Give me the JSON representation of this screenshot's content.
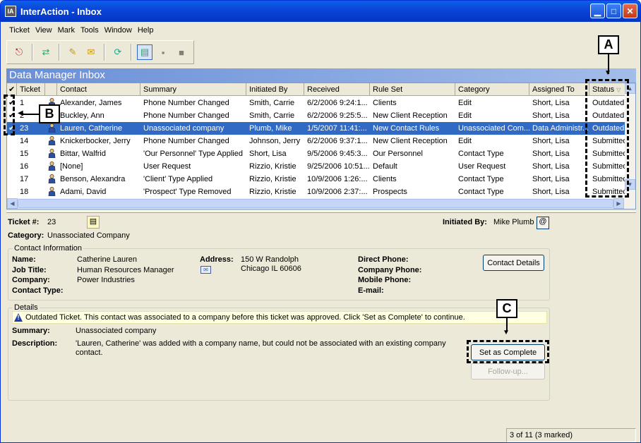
{
  "window": {
    "title": "InterAction - Inbox",
    "app_icon": "IA"
  },
  "menu": [
    "Ticket",
    "View",
    "Mark",
    "Tools",
    "Window",
    "Help"
  ],
  "inbox_title": "Data Manager Inbox",
  "columns": [
    "Ticket",
    "Contact",
    "Summary",
    "Initiated By",
    "Received",
    "Rule Set",
    "Category",
    "Assigned To",
    "Status"
  ],
  "rows": [
    {
      "check": "✔",
      "ticket": "1",
      "contact": "Alexander, James",
      "summary": "Phone Number Changed",
      "initiated_by": "Smith, Carrie",
      "received": "6/2/2006 9:24:1...",
      "rule_set": "Clients",
      "category": "Edit",
      "assigned_to": "Short, Lisa",
      "status": "Outdated"
    },
    {
      "check": "✔",
      "ticket": "2",
      "contact": "Buckley, Ann",
      "summary": "Phone Number Changed",
      "initiated_by": "Smith, Carrie",
      "received": "6/2/2006 9:25:5...",
      "rule_set": "New Client Reception",
      "category": "Edit",
      "assigned_to": "Short, Lisa",
      "status": "Outdated"
    },
    {
      "check": "✔",
      "ticket": "23",
      "contact": "Lauren, Catherine",
      "summary": "Unassociated company",
      "initiated_by": "Plumb, Mike",
      "received": "1/5/2007 11:41:...",
      "rule_set": "New Contact Rules",
      "category": "Unassociated Com...",
      "assigned_to": "Data Administr...",
      "status": "Outdated",
      "selected": true
    },
    {
      "check": "",
      "ticket": "14",
      "contact": "Knickerbocker, Jerry",
      "summary": "Phone Number Changed",
      "initiated_by": "Johnson, Jerry",
      "received": "6/2/2006 9:37:1...",
      "rule_set": "New Client Reception",
      "category": "Edit",
      "assigned_to": "Short, Lisa",
      "status": "Submitted"
    },
    {
      "check": "",
      "ticket": "15",
      "contact": "Bittar, Walfrid",
      "summary": "'Our Personnel' Type Applied",
      "initiated_by": "Short, Lisa",
      "received": "9/5/2006 9:45:3...",
      "rule_set": "Our Personnel",
      "category": "Contact Type",
      "assigned_to": "Short, Lisa",
      "status": "Submitted"
    },
    {
      "check": "",
      "ticket": "16",
      "contact": "[None]",
      "summary": "User Request",
      "initiated_by": "Rizzio, Kristie",
      "received": "9/25/2006 10:51...",
      "rule_set": "Default",
      "category": "User Request",
      "assigned_to": "Short, Lisa",
      "status": "Submitted"
    },
    {
      "check": "",
      "ticket": "17",
      "contact": "Benson, Alexandra",
      "summary": "'Client' Type Applied",
      "initiated_by": "Rizzio, Kristie",
      "received": "10/9/2006 1:26:...",
      "rule_set": "Clients",
      "category": "Contact Type",
      "assigned_to": "Short, Lisa",
      "status": "Submitted"
    },
    {
      "check": "",
      "ticket": "18",
      "contact": "Adami, David",
      "summary": "'Prospect' Type Removed",
      "initiated_by": "Rizzio, Kristie",
      "received": "10/9/2006 2:37:...",
      "rule_set": "Prospects",
      "category": "Contact Type",
      "assigned_to": "Short, Lisa",
      "status": "Submitted"
    }
  ],
  "detail": {
    "ticket_label": "Ticket #:",
    "ticket_value": "23",
    "category_label": "Category:",
    "category_value": "Unassociated Company",
    "initiated_label": "Initiated By:",
    "initiated_value": "Mike Plumb",
    "contact_group": "Contact Information",
    "name_label": "Name:",
    "name_value": "Catherine Lauren",
    "job_label": "Job Title:",
    "job_value": "Human Resources Manager",
    "company_label": "Company:",
    "company_value": "Power Industries",
    "type_label": "Contact Type:",
    "address_label": "Address:",
    "address_line1": "150 W Randolph",
    "address_line2": "Chicago IL 60606",
    "direct_label": "Direct Phone:",
    "company_phone_label": "Company Phone:",
    "mobile_label": "Mobile Phone:",
    "email_label": "E-mail:",
    "contact_details_btn": "Contact Details",
    "details_group": "Details",
    "notice": "Outdated Ticket. This contact was associated to a company before this ticket was approved. Click 'Set as Complete' to continue.",
    "summary_label": "Summary:",
    "summary_value": "Unassociated company",
    "description_label": "Description:",
    "description_line1": "'Lauren, Catherine' was added with a company name, but could not be associated with an existing company",
    "description_line2": "contact.",
    "set_complete_btn": "Set as Complete",
    "followup_btn": "Follow-up..."
  },
  "statusbar": {
    "count": "3 of 11   (3 marked)"
  },
  "callouts": {
    "a": "A",
    "b": "B",
    "c": "C"
  }
}
